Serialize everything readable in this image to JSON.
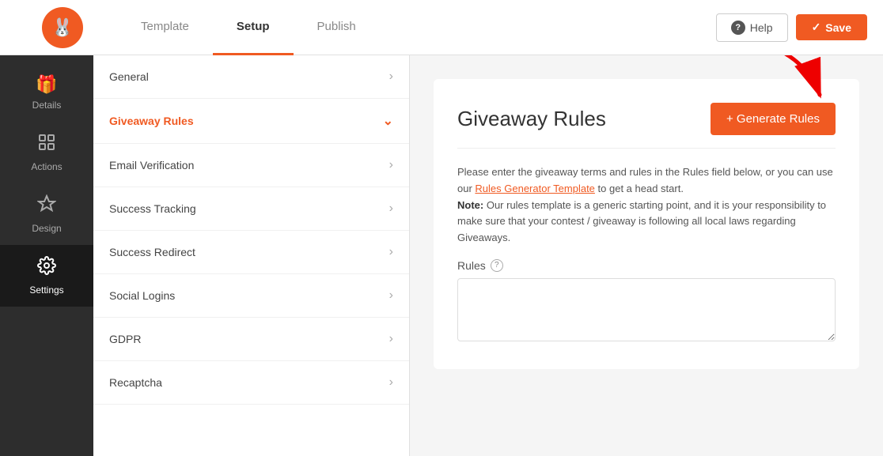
{
  "topNav": {
    "tabs": [
      {
        "id": "template",
        "label": "Template",
        "active": false
      },
      {
        "id": "setup",
        "label": "Setup",
        "active": true
      },
      {
        "id": "publish",
        "label": "Publish",
        "active": false
      }
    ],
    "helpLabel": "Help",
    "saveLabel": "Save"
  },
  "sidebar": {
    "items": [
      {
        "id": "details",
        "label": "Details",
        "icon": "🎁",
        "active": false
      },
      {
        "id": "actions",
        "label": "Actions",
        "icon": "◈",
        "active": false
      },
      {
        "id": "design",
        "label": "Design",
        "icon": "✂",
        "active": false
      },
      {
        "id": "settings",
        "label": "Settings",
        "icon": "⚙",
        "active": true
      }
    ]
  },
  "middleMenu": {
    "items": [
      {
        "id": "general",
        "label": "General",
        "active": false
      },
      {
        "id": "giveaway-rules",
        "label": "Giveaway Rules",
        "active": true
      },
      {
        "id": "email-verification",
        "label": "Email Verification",
        "active": false
      },
      {
        "id": "success-tracking",
        "label": "Success Tracking",
        "active": false
      },
      {
        "id": "success-redirect",
        "label": "Success Redirect",
        "active": false
      },
      {
        "id": "social-logins",
        "label": "Social Logins",
        "active": false
      },
      {
        "id": "gdpr",
        "label": "GDPR",
        "active": false
      },
      {
        "id": "recaptcha",
        "label": "Recaptcha",
        "active": false
      }
    ]
  },
  "contentPanel": {
    "title": "Giveaway Rules",
    "generateBtnLabel": "+ Generate Rules",
    "description1": "Please enter the giveaway terms and rules in the Rules field below, or you can use our ",
    "linkText": "Rules Generator Template",
    "description2": " to get a head start.",
    "noteLabel": "Note:",
    "noteText": " Our rules template is a generic starting point, and it is your responsibility to make sure that your contest / giveaway is following all local laws regarding Giveaways.",
    "rulesLabel": "Rules",
    "rulesPlaceholder": ""
  }
}
